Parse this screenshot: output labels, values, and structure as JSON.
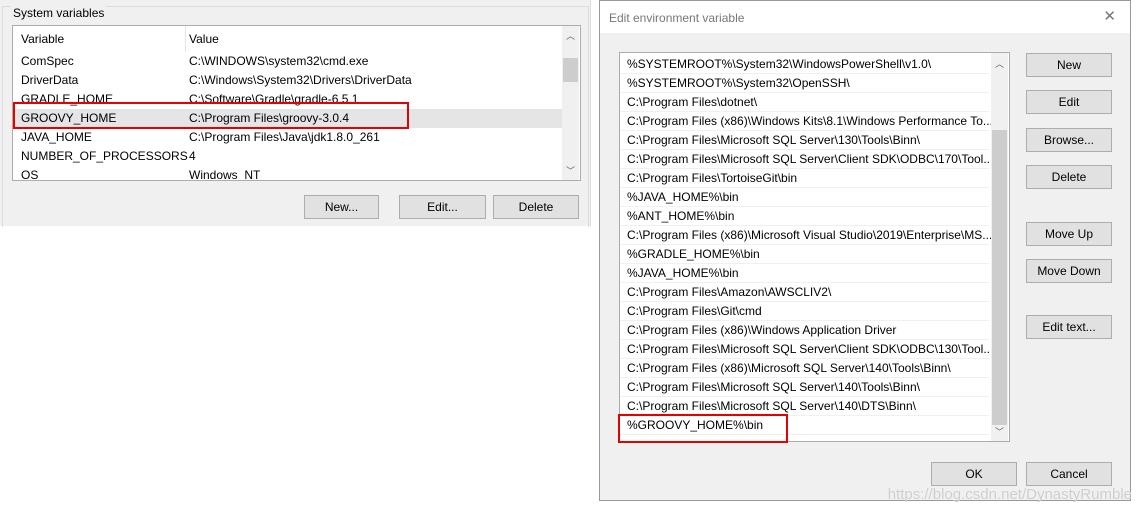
{
  "system_vars": {
    "group_title": "System variables",
    "columns": [
      "Variable",
      "Value"
    ],
    "rows": [
      {
        "name": "ComSpec",
        "value": "C:\\WINDOWS\\system32\\cmd.exe"
      },
      {
        "name": "DriverData",
        "value": "C:\\Windows\\System32\\Drivers\\DriverData"
      },
      {
        "name": "GRADLE_HOME",
        "value": "C:\\Software\\Gradle\\gradle-6.5.1"
      },
      {
        "name": "GROOVY_HOME",
        "value": "C:\\Program Files\\groovy-3.0.4"
      },
      {
        "name": "JAVA_HOME",
        "value": "C:\\Program Files\\Java\\jdk1.8.0_261"
      },
      {
        "name": "NUMBER_OF_PROCESSORS",
        "value": "4"
      },
      {
        "name": "OS",
        "value": "Windows_NT"
      }
    ],
    "buttons": {
      "new": "New...",
      "edit": "Edit...",
      "delete": "Delete"
    }
  },
  "dialog": {
    "title": "Edit environment variable",
    "close": "✕",
    "entries": [
      "%SYSTEMROOT%\\System32\\WindowsPowerShell\\v1.0\\",
      "%SYSTEMROOT%\\System32\\OpenSSH\\",
      "C:\\Program Files\\dotnet\\",
      "C:\\Program Files (x86)\\Windows Kits\\8.1\\Windows Performance To...",
      "C:\\Program Files\\Microsoft SQL Server\\130\\Tools\\Binn\\",
      "C:\\Program Files\\Microsoft SQL Server\\Client SDK\\ODBC\\170\\Tool...",
      "C:\\Program Files\\TortoiseGit\\bin",
      "%JAVA_HOME%\\bin",
      "%ANT_HOME%\\bin",
      "C:\\Program Files (x86)\\Microsoft Visual Studio\\2019\\Enterprise\\MS...",
      "%GRADLE_HOME%\\bin",
      "%JAVA_HOME%\\bin",
      "C:\\Program Files\\Amazon\\AWSCLIV2\\",
      "C:\\Program Files\\Git\\cmd",
      "C:\\Program Files (x86)\\Windows Application Driver",
      "C:\\Program Files\\Microsoft SQL Server\\Client SDK\\ODBC\\130\\Tool...",
      "C:\\Program Files (x86)\\Microsoft SQL Server\\140\\Tools\\Binn\\",
      "C:\\Program Files\\Microsoft SQL Server\\140\\Tools\\Binn\\",
      "C:\\Program Files\\Microsoft SQL Server\\140\\DTS\\Binn\\",
      "%GROOVY_HOME%\\bin"
    ],
    "buttons": {
      "new": "New",
      "edit": "Edit",
      "browse": "Browse...",
      "delete": "Delete",
      "move_up": "Move Up",
      "move_down": "Move Down",
      "edit_text": "Edit text...",
      "ok": "OK",
      "cancel": "Cancel"
    }
  },
  "watermark": "https://blog.csdn.net/DynastyRumble",
  "colors": {
    "highlight_box": "#e60000"
  }
}
